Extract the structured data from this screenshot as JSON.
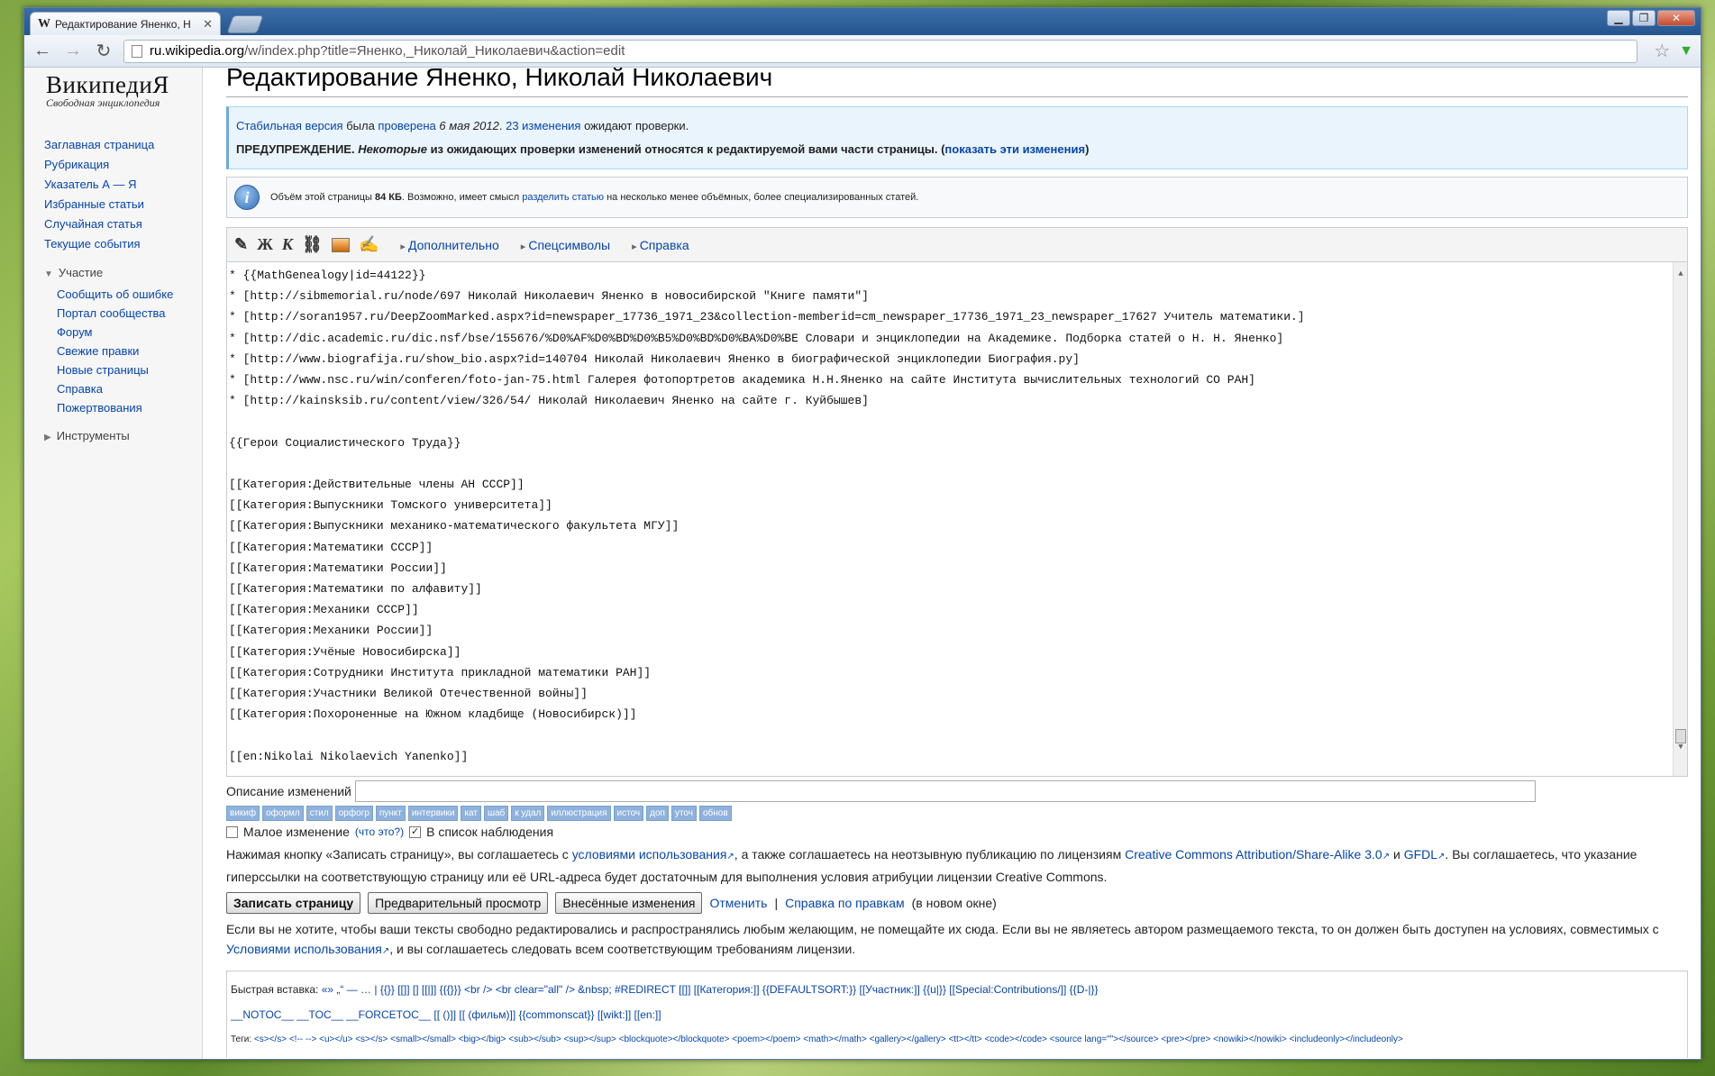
{
  "browser": {
    "tab_title": "Редактирование Яненко, Н",
    "tab_logo": "W",
    "url_host": "ru.wikipedia.org",
    "url_path": "/w/index.php?title=Яненко,_Николай_Николаевич&action=edit"
  },
  "sidebar": {
    "logo_name": "ВикипедиЯ",
    "logo_sub": "Свободная энциклопедия",
    "nav": [
      "Заглавная страница",
      "Рубрикация",
      "Указатель А — Я",
      "Избранные статьи",
      "Случайная статья",
      "Текущие события"
    ],
    "participation_head": "Участие",
    "participation": [
      "Сообщить об ошибке",
      "Портал сообщества",
      "Форум",
      "Свежие правки",
      "Новые страницы",
      "Справка",
      "Пожертвования"
    ],
    "tools_head": "Инструменты"
  },
  "page": {
    "title": "Редактирование Яненко, Николай Николаевич",
    "flag": {
      "stable": "Стабильная версия",
      "was": " была ",
      "checked": "проверена",
      "date": " 6 мая 2012",
      "sep": ". ",
      "changes": "23 изменения",
      "await": " ожидают проверки.",
      "warn_label": "ПРЕДУПРЕЖДЕНИЕ.",
      "warn_some": " Некоторые",
      "warn_text": " из ожидающих проверки изменений относятся к редактируемой вами части страницы. (",
      "warn_link": "показать эти изменения",
      "warn_close": ")"
    },
    "size_notice": {
      "pre": "Объём этой страницы ",
      "size": "84 КБ",
      "mid": ". Возможно, имеет смысл ",
      "link": "разделить статью",
      "post": " на несколько менее объёмных, более специализированных статей."
    }
  },
  "editor_toolbar": {
    "sig": "✎",
    "bold": "Ж",
    "italic": "К",
    "more": "Дополнительно",
    "special": "Спецсимволы",
    "help": "Справка"
  },
  "editor_text": "* {{MathGenealogy|id=44122}}\n* [http://sibmemorial.ru/node/697 Николай Николаевич Яненко в новосибирской \"Книге памяти\"]\n* [http://soran1957.ru/DeepZoomMarked.aspx?id=newspaper_17736_1971_23&collection-memberid=cm_newspaper_17736_1971_23_newspaper_17627 Учитель математики.]\n* [http://dic.academic.ru/dic.nsf/bse/155676/%D0%AF%D0%BD%D0%B5%D0%BD%D0%BA%D0%BE Словари и энциклопедии на Академике. Подборка статей о Н. Н. Яненко]\n* [http://www.biografija.ru/show_bio.aspx?id=140704 Николай Николаевич Яненко в биографической энциклопедии Биография.ру]\n* [http://www.nsc.ru/win/conferen/foto-jan-75.html Галерея фотопортретов академика Н.Н.Яненко на сайте Института вычислительных технологий СО РАН]\n* [http://kainsksib.ru/content/view/326/54/ Николай Николаевич Яненко на сайте г. Куйбышев]\n\n{{Герои Социалистического Труда}}\n\n[[Категория:Действительные члены АН СССР]]\n[[Категория:Выпускники Томского университета]]\n[[Категория:Выпускники механико-математического факультета МГУ]]\n[[Категория:Математики СССР]]\n[[Категория:Математики России]]\n[[Категория:Математики по алфавиту]]\n[[Категория:Механики СССР]]\n[[Категория:Механики России]]\n[[Категория:Учёные Новосибирска]]\n[[Категория:Сотрудники Института прикладной математики РАН]]\n[[Категория:Участники Великой Отечественной войны]]\n[[Категория:Похороненные на Южном кладбище (Новосибирск)]]\n\n[[en:Nikolai Nikolaevich Yanenko]]",
  "summary": {
    "label": "Описание изменений",
    "value": "",
    "chips": [
      "викиф",
      "оформл",
      "стил",
      "орфогр",
      "пункт",
      "интервики",
      "кат",
      "шаб",
      "к удал",
      "иллюстрация",
      "источ",
      "доп",
      "уточ",
      "обнов"
    ]
  },
  "checks": {
    "minor": "Малое изменение",
    "minor_help": "(что это?)",
    "watch": "В список наблюдения"
  },
  "license": {
    "p1": "Нажимая кнопку «Записать страницу», вы соглашаетесь с ",
    "terms": "условиями использования",
    "p2": ", а также соглашаетесь на неотзывную публикацию по лицензиям ",
    "ccbysa": "Creative Commons Attribution/Share-Alike 3.0",
    "and": " и ",
    "gfdl": "GFDL",
    "p3": ". Вы соглашаетесь, что указание гиперссылки на соответствующую страницу или её URL-адреса будет достаточным для выполнения условия атрибуции лицензии Creative Commons."
  },
  "buttons": {
    "save": "Записать страницу",
    "preview": "Предварительный просмотр",
    "diff": "Внесённые изменения",
    "cancel": "Отменить",
    "sep": "|",
    "help": "Справка по правкам",
    "newwin": "(в новом окне)"
  },
  "copyright": {
    "p1": "Если вы не хотите, чтобы ваши тексты свободно редактировались и распространялись любым желающим, не помещайте их сюда. Если вы не являетесь автором размещаемого текста, то он должен быть доступен на условиях, совместимых с ",
    "link": "Условиями использования",
    "p2": ", и вы соглашаетесь следовать всем соответствующим требованиям лицензии."
  },
  "quick": {
    "label": "Быстрая вставка:",
    "line1": "«» „“ — … | {{}} [[]] [] [[|]] {{{}}} <br /> <br clear=\"all\" /> &nbsp; #REDIRECT [[]] [[Категория:]] {{DEFAULTSORT:}} [[Участник:]] {{u|}} [[Special:Contributions/]] {{D-|}}",
    "line2": "__NOTOC__ __TOC__ __FORCETOC__ [[ ()]] [[ (фильм)]] {{commonscat}} [[wikt:]] [[en:]]",
    "tags_label": "Теги:",
    "line3": "<s></s> <!-- --> <u></u> <s></s> <small></small> <big></big> <sub></sub> <sup></sup> <blockquote></blockquote> <poem></poem> <math></math> <gallery></gallery> <tt></tt> <code></code> <source lang=\"\"></source> <pre></pre> <nowiki></nowiki> <includeonly></includeonly>"
  }
}
